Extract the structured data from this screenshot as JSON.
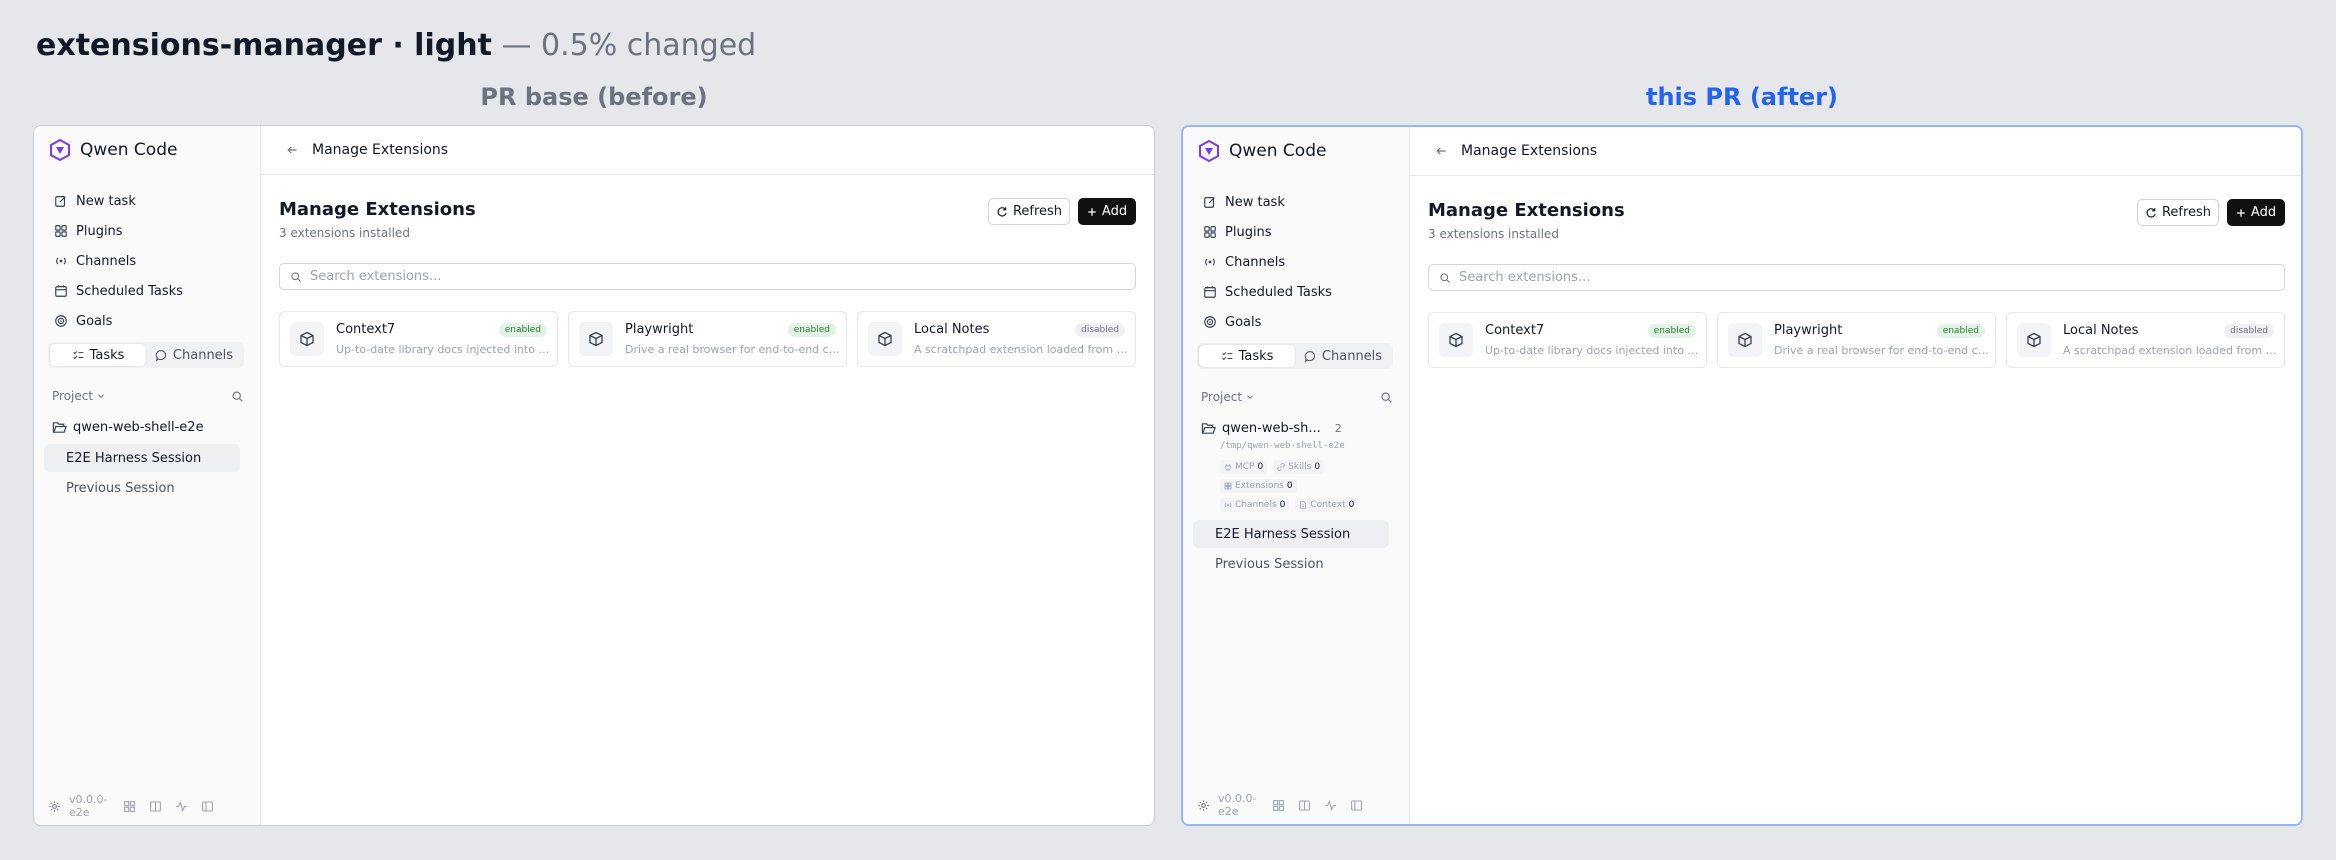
{
  "header": {
    "title_strong": "extensions-manager · light",
    "title_muted": "— 0.5% changed"
  },
  "columns": {
    "before_label": "PR base (before)",
    "after_label": "this PR (after)"
  },
  "colors": {
    "after_accent": "#2563eb",
    "brand": "#7c3aed",
    "add_button": "#111111",
    "enabled_badge": "#2e7d32"
  },
  "app": {
    "name": "Qwen Code",
    "nav": [
      {
        "label": "New task",
        "icon": "edit-icon"
      },
      {
        "label": "Plugins",
        "icon": "puzzle-icon"
      },
      {
        "label": "Channels",
        "icon": "broadcast-icon"
      },
      {
        "label": "Scheduled Tasks",
        "icon": "calendar-icon"
      },
      {
        "label": "Goals",
        "icon": "target-icon"
      }
    ],
    "segment": {
      "tasks": "Tasks",
      "channels": "Channels",
      "active": "Tasks"
    },
    "project_label": "Project",
    "version": "v0.0.0-e2e",
    "before": {
      "folder": "qwen-web-shell-e2e",
      "sessions": [
        "E2E Harness Session",
        "Previous Session"
      ]
    },
    "after": {
      "folder": "qwen-web-sh...",
      "folder_count": "2",
      "path": "/tmp/qwen-web-shell-e2e",
      "stats": [
        {
          "label": "MCP",
          "value": "0",
          "icon": "plug-icon"
        },
        {
          "label": "Skills",
          "value": "0",
          "icon": "link-icon"
        },
        {
          "label": "Extensions",
          "value": "0",
          "icon": "puzzle-icon"
        },
        {
          "label": "Channels",
          "value": "0",
          "icon": "broadcast-icon"
        },
        {
          "label": "Context",
          "value": "0",
          "icon": "file-icon"
        }
      ],
      "sessions": [
        "E2E Harness Session",
        "Previous Session"
      ]
    }
  },
  "main": {
    "topbar_title": "Manage Extensions",
    "heading": "Manage Extensions",
    "subheading": "3 extensions installed",
    "refresh_label": "Refresh",
    "add_label": "Add",
    "search_placeholder": "Search extensions...",
    "extensions": [
      {
        "name": "Context7",
        "description": "Up-to-date library docs injected into y...",
        "status": "enabled"
      },
      {
        "name": "Playwright",
        "description": "Drive a real browser for end-to-end ch...",
        "status": "enabled"
      },
      {
        "name": "Local Notes",
        "description": "A scratchpad extension loaded from d...",
        "status": "disabled"
      }
    ]
  }
}
